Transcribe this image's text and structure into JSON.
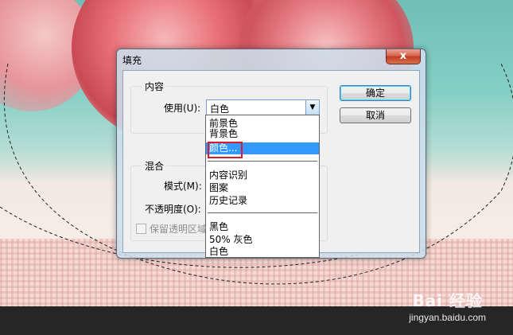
{
  "dialog": {
    "title": "填充",
    "close_label": "x",
    "content_group": {
      "legend": "内容",
      "use_label": "使用(U):",
      "use_value": "白色"
    },
    "blend_group": {
      "legend": "混合",
      "mode_label": "模式(M):",
      "opacity_label": "不透明度(O):",
      "preserve_label": "保留透明区域"
    },
    "buttons": {
      "ok": "确定",
      "cancel": "取消"
    },
    "dropdown_items": {
      "foreground": "前景色",
      "background": "背景色",
      "color": "颜色...",
      "content_aware": "内容识别",
      "pattern": "图案",
      "history": "历史记录",
      "black": "黑色",
      "gray50": "50% 灰色",
      "white": "白色"
    },
    "selected_item": "颜色..."
  },
  "watermark": {
    "brand": "Bai 经验",
    "url": "jingyan.baidu.com"
  },
  "colors": {
    "selection": "#3399ff",
    "highlight_box": "#e0182d",
    "close_button": "#c23b22"
  }
}
